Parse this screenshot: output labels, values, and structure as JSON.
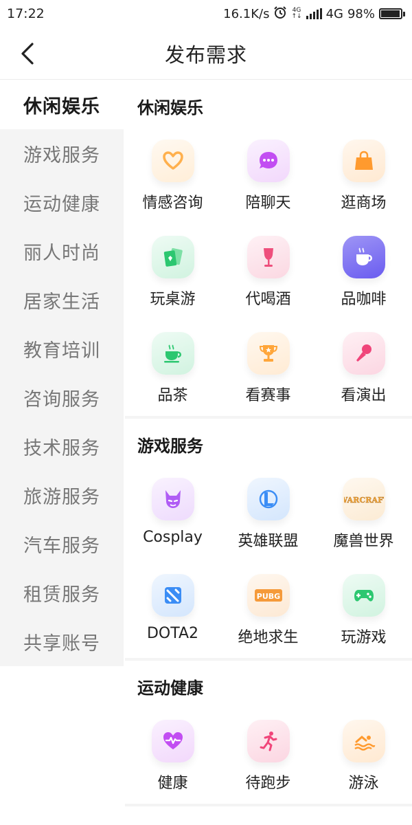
{
  "status_bar": {
    "time": "17:22",
    "speed": "16.1K/s",
    "net_small_top": "4G",
    "net_small_bottom": "↑↓",
    "network": "4G",
    "battery": "98%"
  },
  "header": {
    "title": "发布需求"
  },
  "sidebar": {
    "items": [
      {
        "label": "休闲娱乐"
      },
      {
        "label": "游戏服务"
      },
      {
        "label": "运动健康"
      },
      {
        "label": "丽人时尚"
      },
      {
        "label": "居家生活"
      },
      {
        "label": "教育培训"
      },
      {
        "label": "咨询服务"
      },
      {
        "label": "技术服务"
      },
      {
        "label": "旅游服务"
      },
      {
        "label": "汽车服务"
      },
      {
        "label": "租赁服务"
      },
      {
        "label": "共享账号"
      }
    ]
  },
  "sections": [
    {
      "title": "休闲娱乐",
      "items": [
        {
          "label": "情感咨询",
          "icon": "heart-icon",
          "color": "#ffb04d"
        },
        {
          "label": "陪聊天",
          "icon": "chat-bubble-icon",
          "color": "#c24ef2"
        },
        {
          "label": "逛商场",
          "icon": "shopping-bag-icon",
          "color": "#ff9a2e"
        },
        {
          "label": "玩桌游",
          "icon": "playing-cards-icon",
          "color": "#2cc770"
        },
        {
          "label": "代喝酒",
          "icon": "wine-glass-icon",
          "color": "#ee4f7c"
        },
        {
          "label": "品咖啡",
          "icon": "coffee-cup-icon",
          "color": "#6a5cf0"
        },
        {
          "label": "品茶",
          "icon": "tea-cup-icon",
          "color": "#2cc770"
        },
        {
          "label": "看赛事",
          "icon": "trophy-icon",
          "color": "#ffa63a"
        },
        {
          "label": "看演出",
          "icon": "microphone-icon",
          "color": "#f0457a"
        }
      ]
    },
    {
      "title": "游戏服务",
      "items": [
        {
          "label": "Cosplay",
          "icon": "cosplay-mask-icon",
          "color": "#b05cf5"
        },
        {
          "label": "英雄联盟",
          "icon": "lol-logo-icon",
          "color": "#3b8df5"
        },
        {
          "label": "魔兽世界",
          "icon": "warcraft-logo-icon",
          "color": "#f0a53a",
          "logo_text": "WARCRAFT"
        },
        {
          "label": "DOTA2",
          "icon": "dota2-logo-icon",
          "color": "#3b8df5"
        },
        {
          "label": "绝地求生",
          "icon": "pubg-logo-icon",
          "color": "#f59a3a",
          "logo_text": "PUBG"
        },
        {
          "label": "玩游戏",
          "icon": "gamepad-icon",
          "color": "#2cc770"
        }
      ]
    },
    {
      "title": "运动健康",
      "items": [
        {
          "label": "健康",
          "icon": "heart-pulse-icon",
          "color": "#c24ef2"
        },
        {
          "label": "待跑步",
          "icon": "runner-icon",
          "color": "#f0457a"
        },
        {
          "label": "游泳",
          "icon": "swimmer-icon",
          "color": "#ff9a2e"
        }
      ]
    }
  ]
}
